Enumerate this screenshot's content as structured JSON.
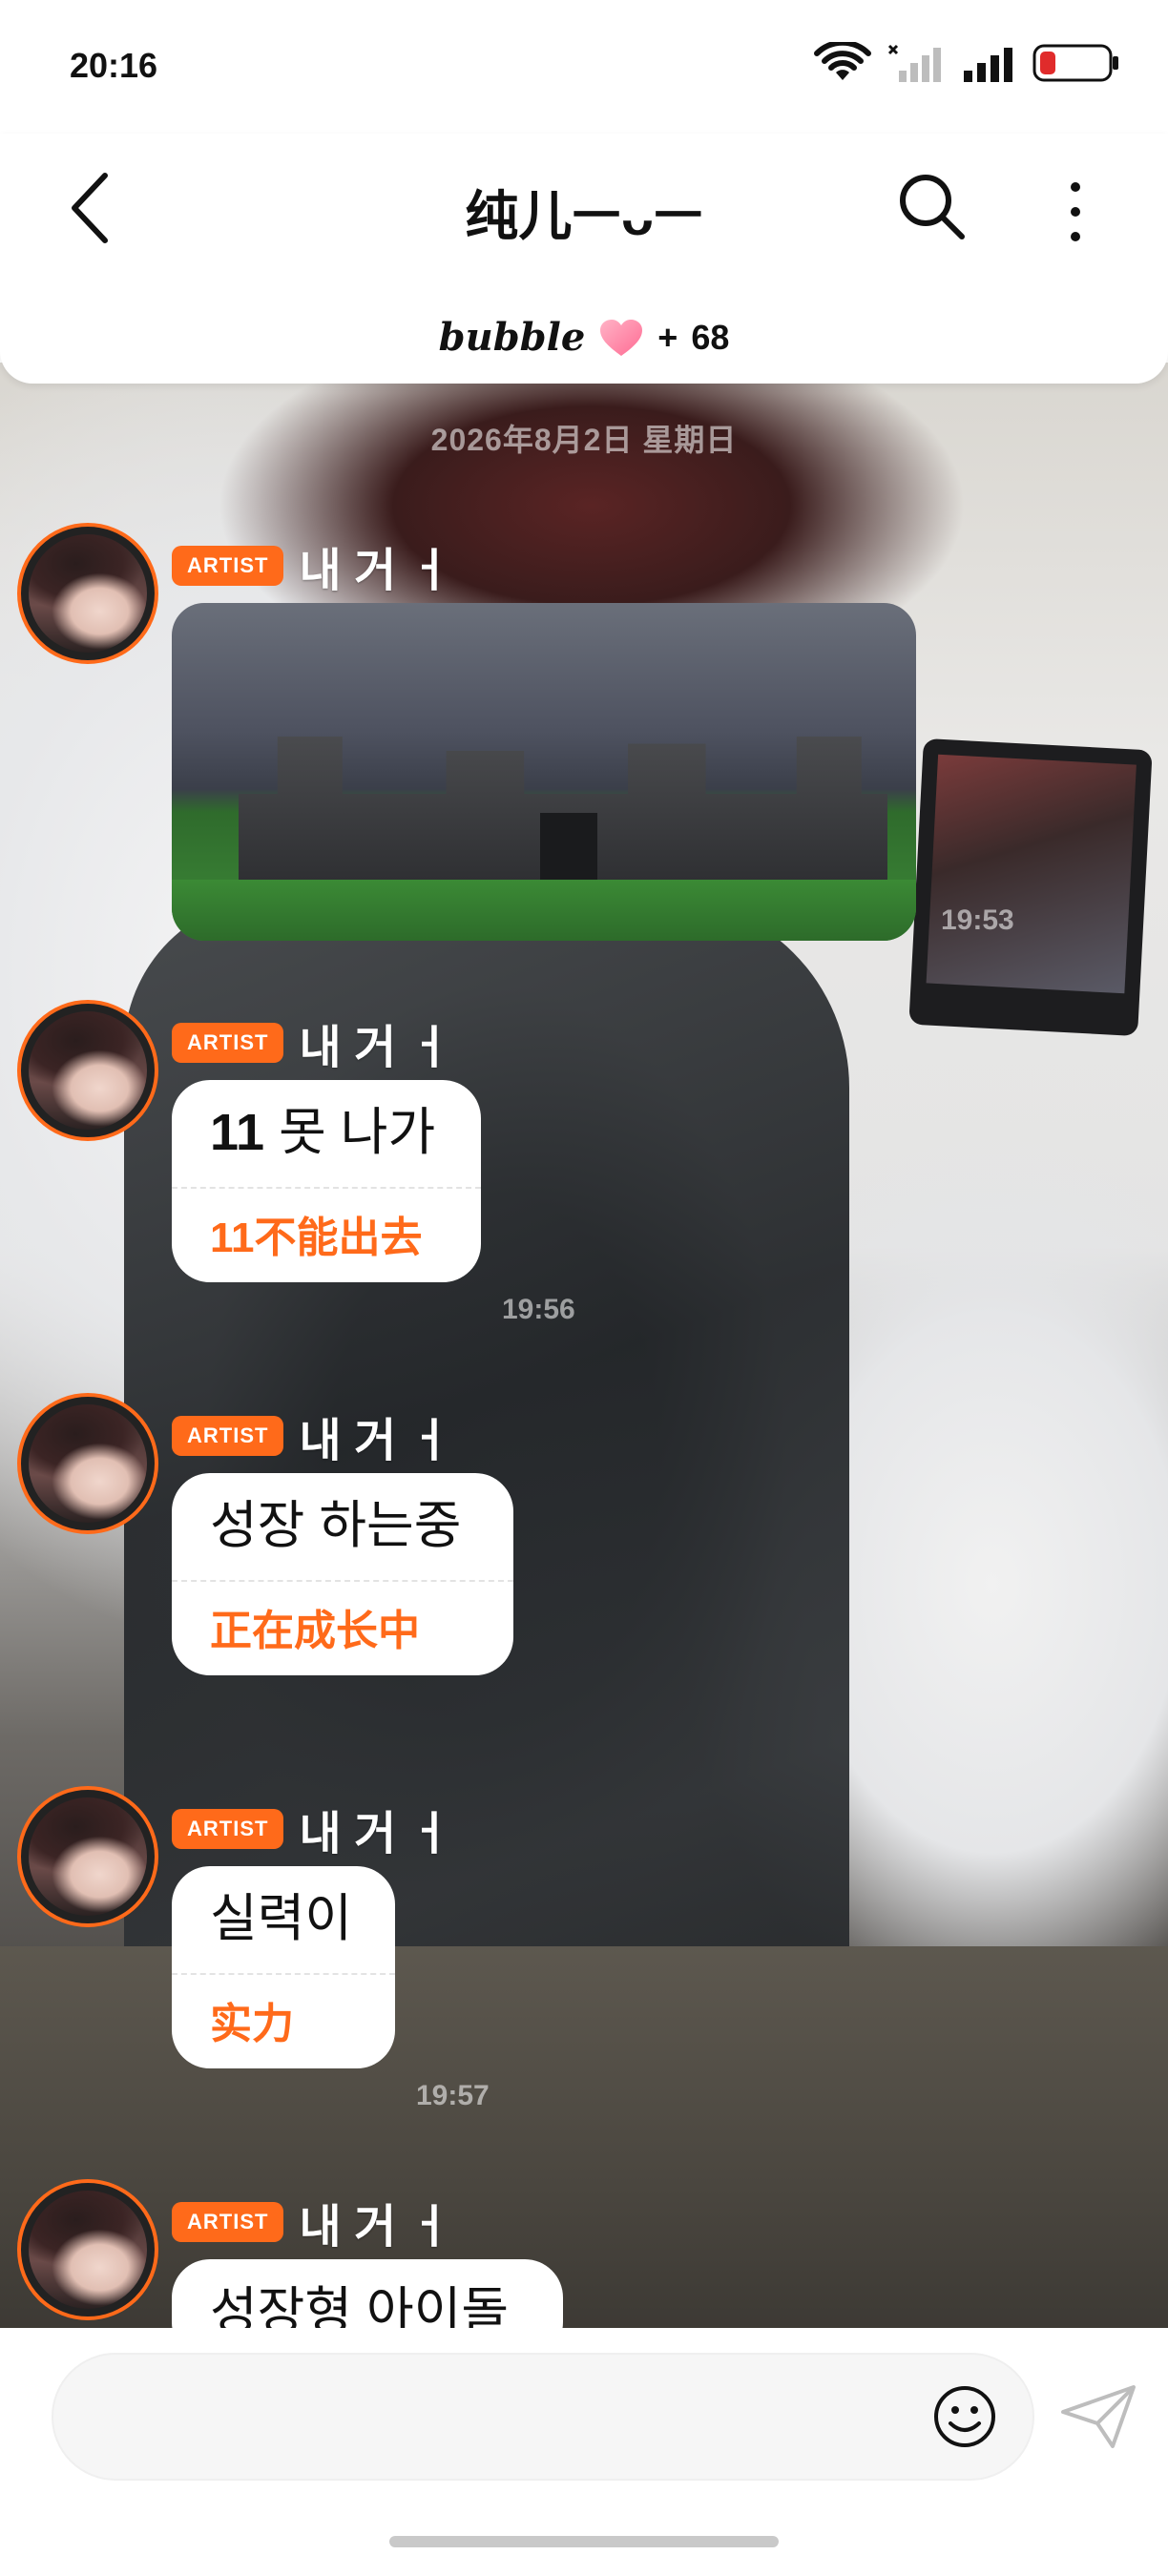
{
  "status_bar": {
    "time": "20:16",
    "icons": [
      "wifi-icon",
      "no-signal-icon",
      "signal-icon",
      "battery-low-icon"
    ],
    "battery_color": "#e02b2b"
  },
  "header": {
    "title": "纯儿ㅡᴗㅡ",
    "brand": "bubble",
    "plus": "+",
    "count": "68"
  },
  "chat": {
    "date": "2026年8月2日 星期日",
    "messages": [
      {
        "badge": "ARTIST",
        "author": "내 거 ㅓ",
        "type": "image",
        "time": "19:53"
      },
      {
        "badge": "ARTIST",
        "author": "내 거 ㅓ",
        "type": "text",
        "ko_num": "11",
        "ko": "못 나가",
        "zh": "11不能出去",
        "time": "19:56"
      },
      {
        "badge": "ARTIST",
        "author": "내 거 ㅓ",
        "type": "text",
        "ko": "성장 하는중",
        "zh": "正在成长中"
      },
      {
        "badge": "ARTIST",
        "author": "내 거 ㅓ",
        "type": "text",
        "ko": "실력이",
        "zh": "实力",
        "time": "19:57"
      },
      {
        "badge": "ARTIST",
        "author": "내 거 ㅓ",
        "type": "text",
        "ko": "성장형 아이돌"
      }
    ]
  },
  "colors": {
    "accent": "#ff6a1a"
  }
}
